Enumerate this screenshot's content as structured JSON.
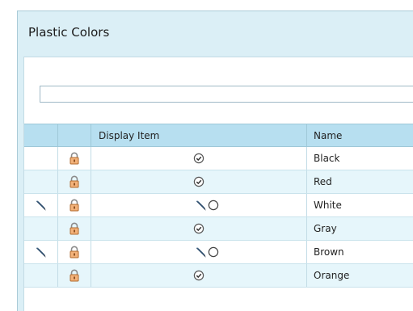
{
  "panel": {
    "title": "Plastic Colors"
  },
  "search": {
    "value": "",
    "placeholder": ""
  },
  "grid": {
    "headers": {
      "edit": "",
      "lock": "",
      "display_item": "Display Item",
      "name": "Name"
    },
    "rows": [
      {
        "name": "Black",
        "editable": false,
        "locked": true,
        "display_item": "checked"
      },
      {
        "name": "Red",
        "editable": false,
        "locked": true,
        "display_item": "checked"
      },
      {
        "name": "White",
        "editable": true,
        "locked": true,
        "display_item": "unchecked-editable"
      },
      {
        "name": "Gray",
        "editable": false,
        "locked": true,
        "display_item": "checked"
      },
      {
        "name": "Brown",
        "editable": true,
        "locked": true,
        "display_item": "unchecked-editable"
      },
      {
        "name": "Orange",
        "editable": false,
        "locked": true,
        "display_item": "checked"
      }
    ]
  },
  "icons": {
    "edit": "pencil-icon",
    "lock": "lock-icon",
    "checked": "check-circle-icon",
    "unchecked": "empty-circle-icon"
  },
  "colors": {
    "panel_bg": "#dbeff6",
    "header_bg": "#b7dff0",
    "row_alt": "#e6f6fb"
  }
}
